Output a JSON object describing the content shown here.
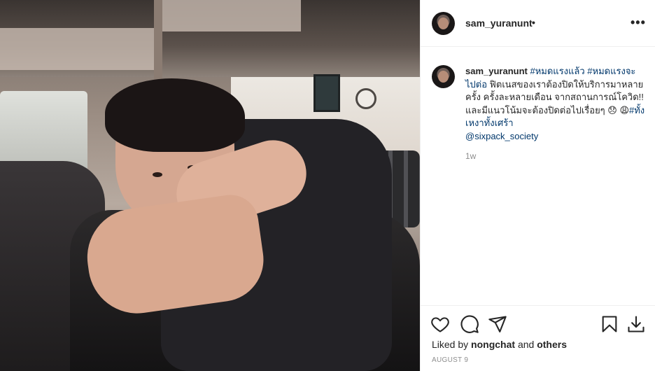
{
  "post": {
    "author": "sam_yuranunt",
    "header_dot": "•",
    "more_label": "•••",
    "caption": {
      "tag1": "#หมดแรงแล้ว",
      "tag2": "#หมดแรงจะไปต่อ",
      "text": "ฟิตเนสของเราต้องปิดให้บริการมาหลายครั้ง ครั้งละหลายเดือน จากสถานการณ์โควิด!! และมีแนวโน้มจะต้องปิดต่อไปเรื่อยๆ 😞 😩",
      "tag3": "#ทั้งเหงาทั้งเศร้า",
      "mention": "@sixpack_society"
    },
    "time_ago": "1w",
    "likes": {
      "prefix": "Liked by",
      "user": "nongchat",
      "joiner": "and",
      "others": "others"
    },
    "date": "AUGUST 9"
  },
  "icons": {
    "header_avatar": "avatar",
    "more": "more-options-icon",
    "like": "heart-icon",
    "comment": "comment-icon",
    "share": "share-icon",
    "save": "bookmark-icon",
    "download": "download-icon"
  }
}
